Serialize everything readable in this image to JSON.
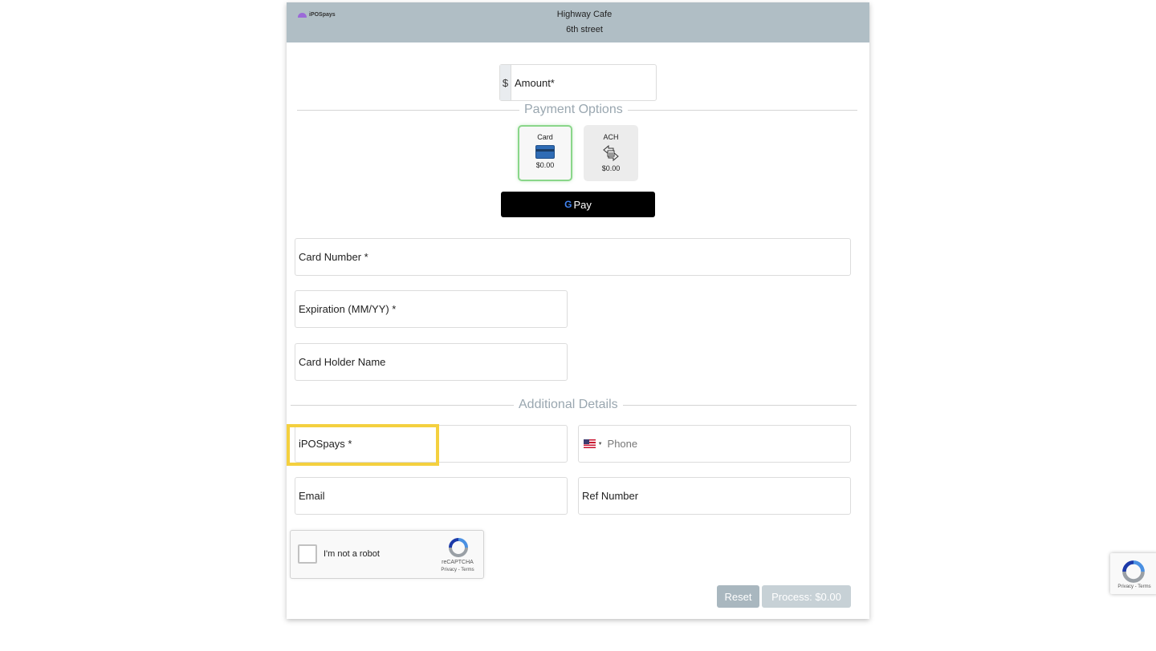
{
  "header": {
    "logo_text": "iPOSpays",
    "merchant_name": "Highway Cafe",
    "merchant_address": "6th street",
    "background_color": "#b0bec5"
  },
  "amount": {
    "prefix": "$",
    "placeholder": "Amount*"
  },
  "payment_options": {
    "title": "Payment Options",
    "options": [
      {
        "label": "Card",
        "amount": "$0.00",
        "icon": "credit-card-icon",
        "selected": true
      },
      {
        "label": "ACH",
        "amount": "$0.00",
        "icon": "bank-transfer-icon",
        "selected": false
      }
    ],
    "gpay": {
      "g": "G",
      "label": "Pay"
    }
  },
  "card_fields": {
    "card_number": "Card Number *",
    "expiration": "Expiration (MM/YY) *",
    "holder_name": "Card Holder Name"
  },
  "additional_details": {
    "title": "Additional Details",
    "name_field": "iPOSpays *",
    "phone_placeholder": "Phone",
    "phone_flag": "us-flag-icon",
    "email": "Email",
    "ref_number": "Ref Number"
  },
  "recaptcha": {
    "label": "I'm not a robot",
    "brand": "reCAPTCHA",
    "links": "Privacy - Terms"
  },
  "buttons": {
    "reset": "Reset",
    "process": "Process: $0.00"
  },
  "colors": {
    "highlight": "#f4d03f",
    "selected_option_border": "#8ad68a"
  }
}
